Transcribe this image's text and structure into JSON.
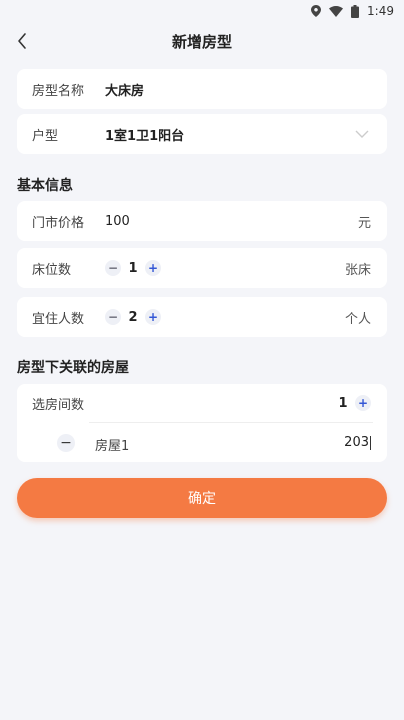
{
  "status_bar": {
    "time": "1:49"
  },
  "header": {
    "title": "新增房型"
  },
  "room_type": {
    "name_label": "房型名称",
    "name_value": "大床房",
    "layout_label": "户型",
    "layout_value": "1室1卫1阳台"
  },
  "basic_info": {
    "section_title": "基本信息",
    "price_label": "门市价格",
    "price_value": "100",
    "price_unit": "元",
    "beds_label": "床位数",
    "beds_value": "1",
    "beds_unit": "张床",
    "guests_label": "宜住人数",
    "guests_value": "2",
    "guests_unit": "个人"
  },
  "rooms": {
    "section_title": "房型下关联的房屋",
    "count_label": "选房间数",
    "count_value": "1",
    "items": [
      {
        "name": "房屋1",
        "number": "203"
      }
    ]
  },
  "stepper": {
    "minus": "−",
    "plus": "+"
  },
  "actions": {
    "confirm_label": "确定"
  },
  "colors": {
    "accent": "#f47a43",
    "stepper_plus": "#3457d5",
    "background": "#f4f5f9"
  }
}
